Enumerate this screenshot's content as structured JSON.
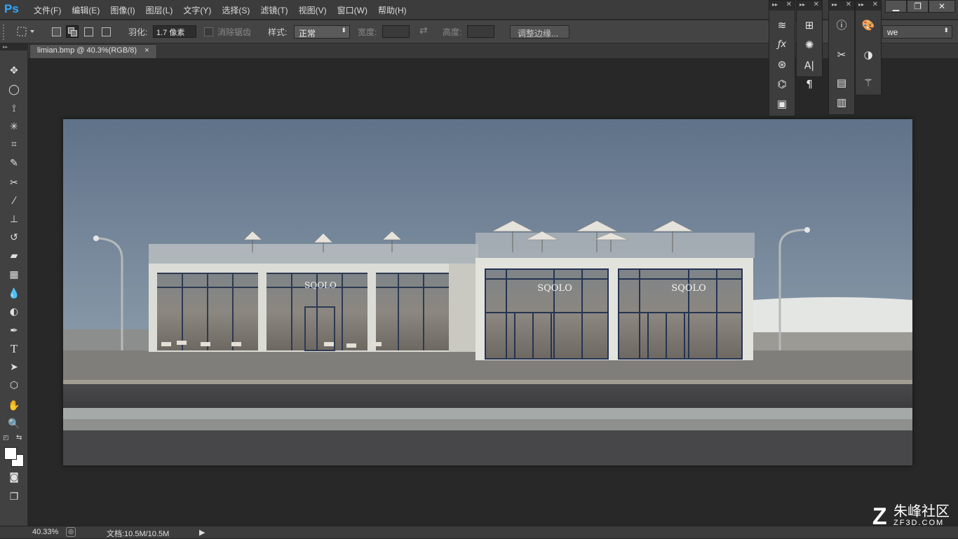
{
  "app": {
    "logo": "Ps"
  },
  "menu": [
    "文件(F)",
    "编辑(E)",
    "图像(I)",
    "图层(L)",
    "文字(Y)",
    "选择(S)",
    "滤镜(T)",
    "视图(V)",
    "窗口(W)",
    "帮助(H)"
  ],
  "window_controls": {
    "minimize": "▁",
    "restore": "❐",
    "close": "✕"
  },
  "options": {
    "feather_label": "羽化:",
    "feather_value": "1.7 像素",
    "antialias_label": "消除锯齿",
    "style_label": "样式:",
    "style_value": "正常",
    "width_label": "宽度:",
    "height_label": "高度:",
    "refine_edge_label": "调整边缘...",
    "workspace_value": "we"
  },
  "document": {
    "tab_title": "limian.bmp @ 40.3%(RGB/8)",
    "close": "×"
  },
  "image": {
    "sign_text": "SQOLO"
  },
  "status": {
    "zoom": "40.33%",
    "doc_info": "文档:10.5M/10.5M"
  },
  "watermark": {
    "brand": "朱峰社区",
    "domain": "ZF3D.COM"
  },
  "colors": {
    "accent": "#31a8ff",
    "ui_bg": "#282828",
    "panel_bg": "#3d3d3d"
  }
}
